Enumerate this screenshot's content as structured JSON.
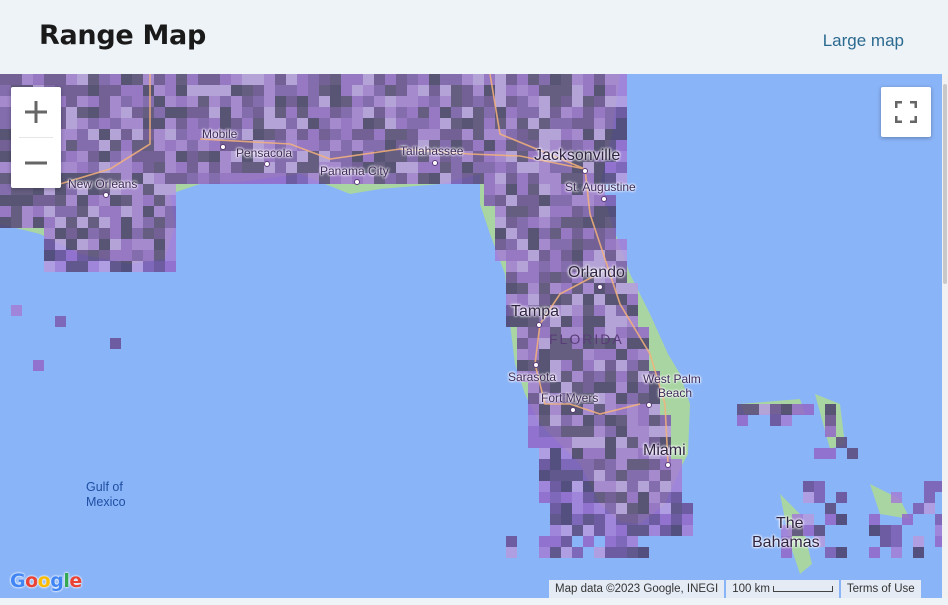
{
  "header": {
    "title": "Range Map",
    "large_map_link": "Large map"
  },
  "map": {
    "controls": {
      "zoom_in": "+",
      "zoom_out": "−"
    },
    "labels": {
      "mobile": "Mobile",
      "pensacola": "Pensacola",
      "tallahassee": "Tallahassee",
      "jacksonville": "Jacksonville",
      "st_augustine": "St. Augustine",
      "new_orleans": "New Orleans",
      "panama_city": "Panama City",
      "orlando": "Orlando",
      "tampa": "Tampa",
      "florida": "FLORIDA",
      "sarasota": "Sarasota",
      "fort_myers": "Fort Myers",
      "west_palm_beach_1": "West Palm",
      "west_palm_beach_2": "Beach",
      "miami": "Miami",
      "gulf_1": "Gulf of",
      "gulf_2": "Mexico",
      "bahamas_1": "The",
      "bahamas_2": "Bahamas"
    },
    "attribution": {
      "google": "Google",
      "map_data": "Map data ©2023 Google, INEGI",
      "scale": "100 km",
      "terms": "Terms of Use"
    },
    "colors": {
      "water": "#8ab4f8",
      "land": "#a8d5a2",
      "range_light": "#a57fd6",
      "range_dark": "#4a3f6b"
    }
  }
}
